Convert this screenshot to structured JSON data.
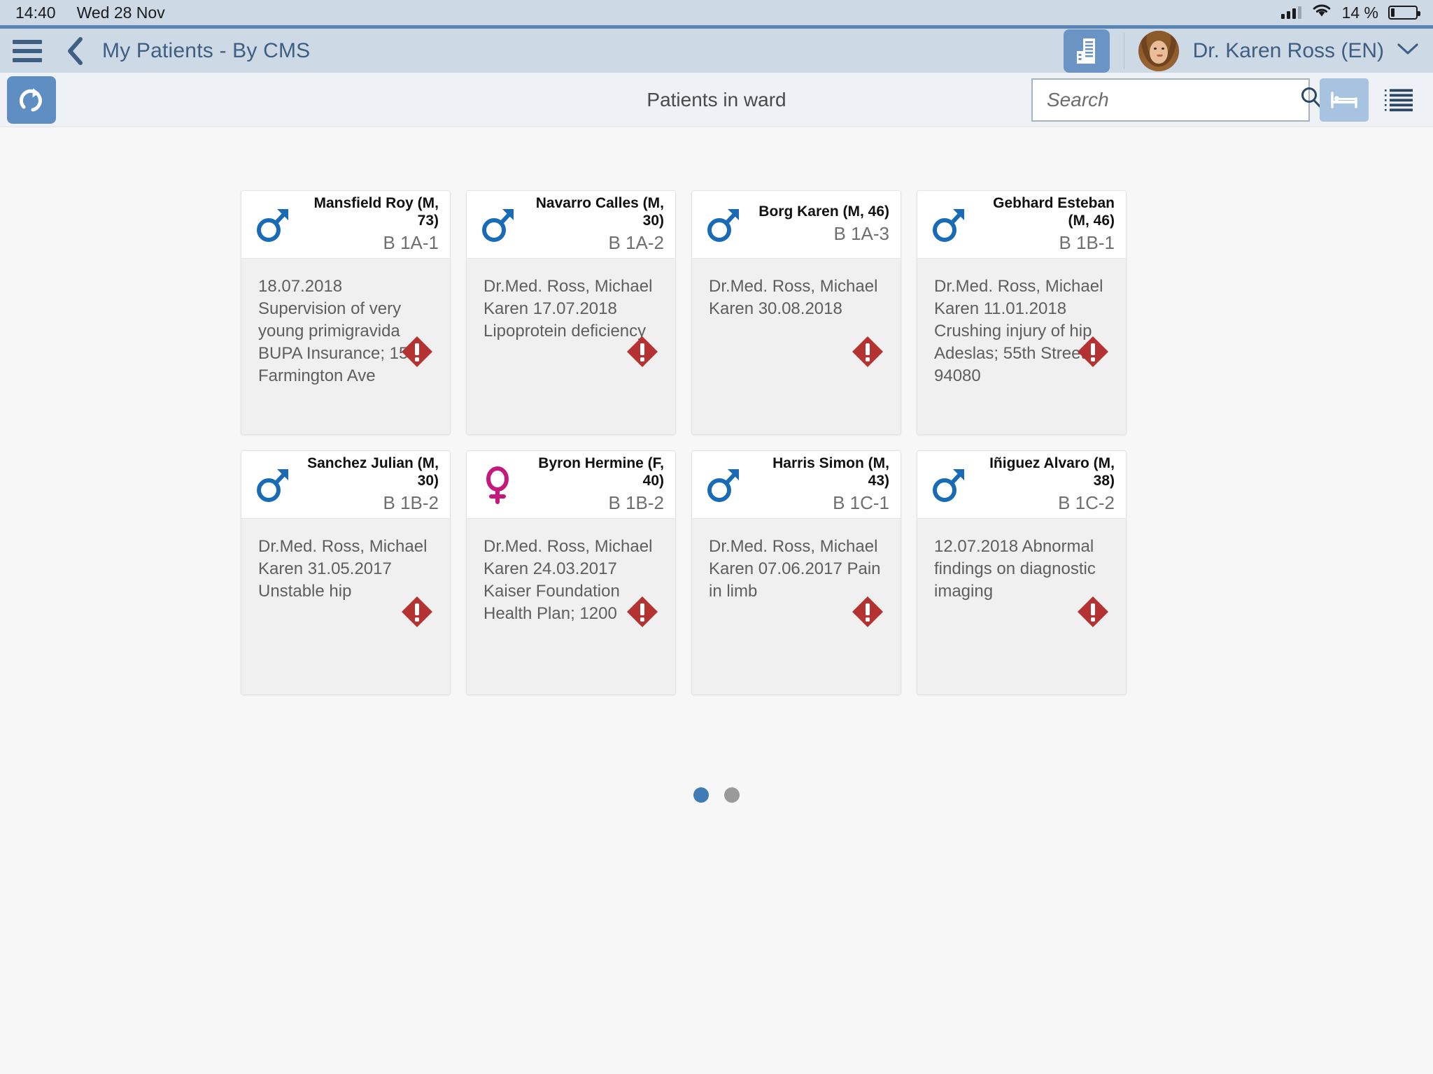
{
  "statusbar": {
    "time": "14:40",
    "date": "Wed 28 Nov",
    "battery_percent": "14 %",
    "signal_icon": "signal-bars-icon",
    "wifi_icon": "wifi-icon",
    "battery_icon": "battery-icon"
  },
  "header": {
    "menu_icon": "hamburger-menu-icon",
    "back_icon": "back-chevron-icon",
    "title": "My Patients - By CMS",
    "facility_icon": "hospital-building-icon",
    "user_name": "Dr. Karen Ross (EN)",
    "user_caret_icon": "chevron-down-icon",
    "avatar_icon": "user-avatar"
  },
  "toolbar": {
    "refresh_icon": "refresh-icon",
    "title": "Patients in ward",
    "search_value": "",
    "search_placeholder": "Search",
    "search_icon": "search-icon",
    "bed_view_icon": "bed-view-icon",
    "list_view_icon": "list-view-icon"
  },
  "patients": [
    {
      "name": "Mansfield Roy (M, 73)",
      "bed": "B 1A-1",
      "gender": "male",
      "gender_icon": "male-gender-icon",
      "details": "18.07.2018 Supervision of very young primigravida BUPA Insurance; 151 Farmington Ave",
      "alert_icon": "alert-warning-icon"
    },
    {
      "name": "Navarro Calles (M, 30)",
      "bed": "B 1A-2",
      "gender": "male",
      "gender_icon": "male-gender-icon",
      "details": "Dr.Med. Ross, Michael Karen 17.07.2018 Lipoprotein deficiency",
      "alert_icon": "alert-warning-icon"
    },
    {
      "name": "Borg Karen (M, 46)",
      "bed": "B 1A-3",
      "gender": "male",
      "gender_icon": "male-gender-icon",
      "details": "Dr.Med. Ross, Michael Karen 30.08.2018",
      "alert_icon": "alert-warning-icon"
    },
    {
      "name": "Gebhard Esteban (M, 46)",
      "bed": "B 1B-1",
      "gender": "male",
      "gender_icon": "male-gender-icon",
      "details": "Dr.Med. Ross, Michael Karen 11.01.2018 Crushing injury of hip Adeslas; 55th Street 94080",
      "alert_icon": "alert-warning-icon"
    },
    {
      "name": "Sanchez Julian (M, 30)",
      "bed": "B 1B-2",
      "gender": "male",
      "gender_icon": "male-gender-icon",
      "details": "Dr.Med. Ross, Michael Karen 31.05.2017 Unstable hip",
      "alert_icon": "alert-warning-icon"
    },
    {
      "name": "Byron Hermine (F, 40)",
      "bed": "B 1B-2",
      "gender": "female",
      "gender_icon": "female-gender-icon",
      "details": "Dr.Med. Ross, Michael Karen 24.03.2017 Kaiser Foundation Health Plan; 1200",
      "alert_icon": "alert-warning-icon"
    },
    {
      "name": "Harris Simon (M, 43)",
      "bed": "B 1C-1",
      "gender": "male",
      "gender_icon": "male-gender-icon",
      "details": "Dr.Med. Ross, Michael Karen 07.06.2017 Pain in limb",
      "alert_icon": "alert-warning-icon"
    },
    {
      "name": "Iñiguez Alvaro (M, 38)",
      "bed": "B 1C-2",
      "gender": "male",
      "gender_icon": "male-gender-icon",
      "details": "12.07.2018 Abnormal findings on diagnostic imaging",
      "alert_icon": "alert-warning-icon"
    }
  ],
  "pagination": {
    "total": 2,
    "active_index": 0
  },
  "colors": {
    "header_bg": "#cdd9e5",
    "accent_blue": "#3f5f82",
    "male_icon": "#1a6bb5",
    "female_icon": "#c4197b",
    "alert_red": "#b53232",
    "active_dot": "#3f7cb5"
  }
}
